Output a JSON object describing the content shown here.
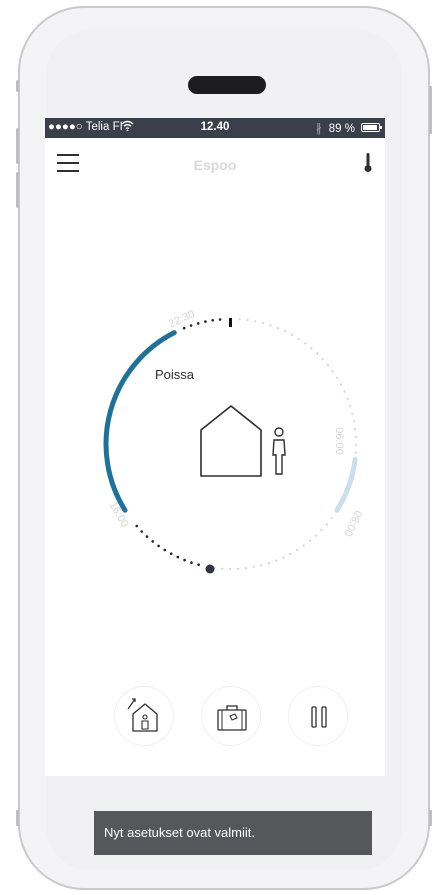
{
  "status_bar": {
    "carrier": "●●●●○ Telia FI",
    "time": "12.40",
    "battery": "89 %"
  },
  "nav": {
    "title": "Espoo",
    "menu_icon": "hamburger-menu-icon",
    "thermometer_icon": "thermometer-icon"
  },
  "dial": {
    "mode_label": "Poissa",
    "time_labels": [
      "22:30",
      "06:00",
      "08:00",
      "16:00"
    ],
    "colors": {
      "active_arc": "#1e7299",
      "light_arc": "#c9dfec",
      "dots": "#d4d4d4"
    }
  },
  "actions": {
    "home_button_icon": "arrive-home-icon",
    "travel_button_icon": "suitcase-icon",
    "pause_button_icon": "pause-icon"
  },
  "toast": {
    "message": "Nyt asetukset ovat valmiit."
  }
}
